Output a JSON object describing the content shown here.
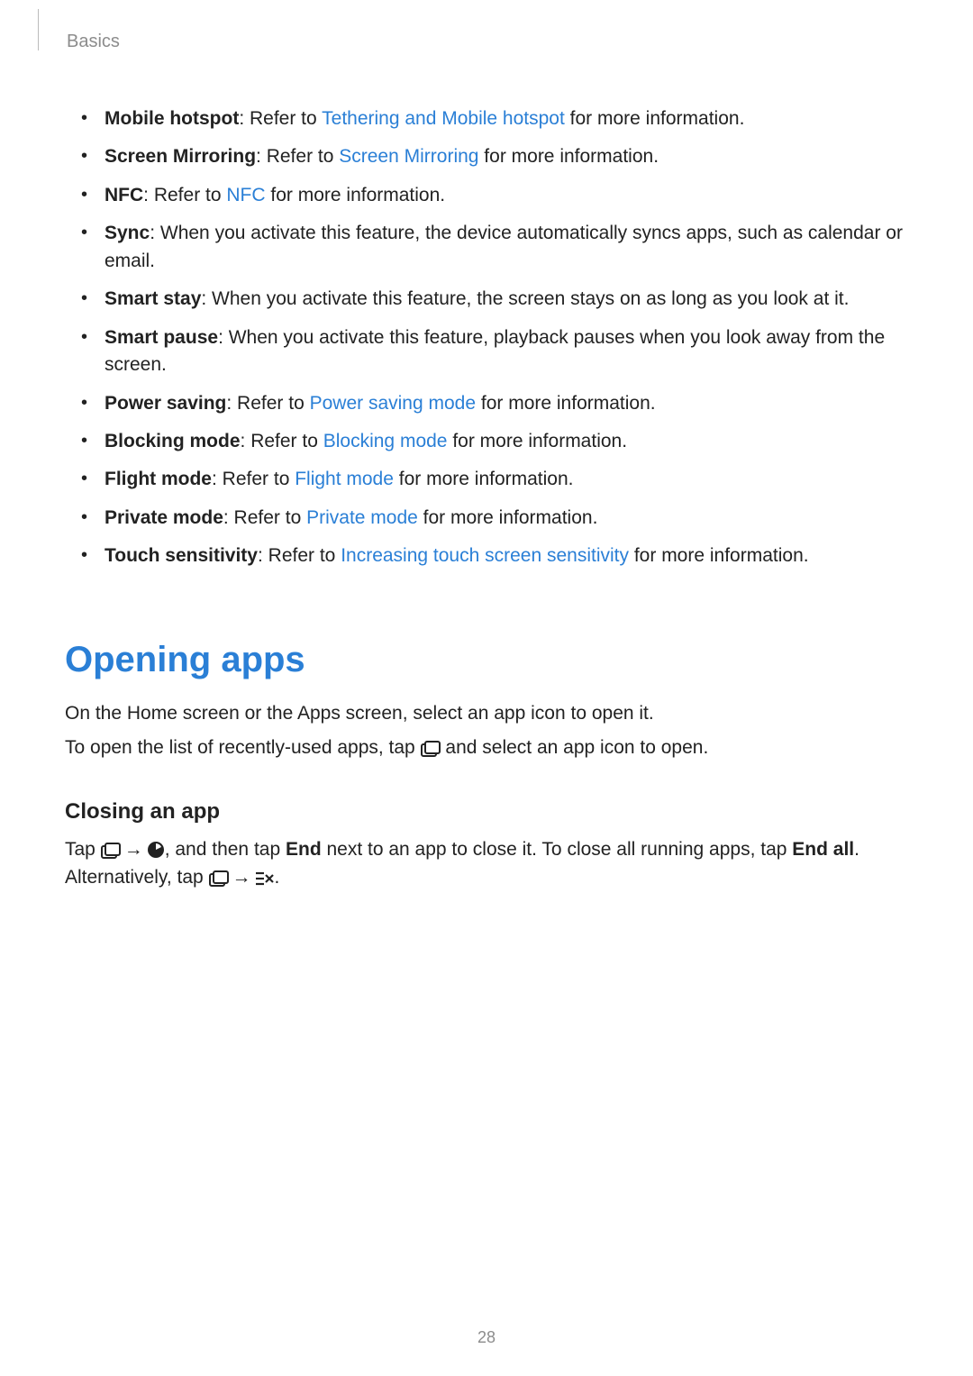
{
  "header": {
    "section": "Basics"
  },
  "features": [
    {
      "term": "Mobile hotspot",
      "before": ": Refer to ",
      "link": "Tethering and Mobile hotspot",
      "after": " for more information."
    },
    {
      "term": "Screen Mirroring",
      "before": ": Refer to ",
      "link": "Screen Mirroring",
      "after": " for more information."
    },
    {
      "term": "NFC",
      "before": ": Refer to ",
      "link": "NFC",
      "after": " for more information."
    },
    {
      "term": "Sync",
      "before": ": When you activate this feature, the device automatically syncs apps, such as calendar or email.",
      "link": "",
      "after": ""
    },
    {
      "term": "Smart stay",
      "before": ": When you activate this feature, the screen stays on as long as you look at it.",
      "link": "",
      "after": ""
    },
    {
      "term": "Smart pause",
      "before": ": When you activate this feature, playback pauses when you look away from the screen.",
      "link": "",
      "after": ""
    },
    {
      "term": "Power saving",
      "before": ": Refer to ",
      "link": "Power saving mode",
      "after": " for more information."
    },
    {
      "term": "Blocking mode",
      "before": ": Refer to ",
      "link": "Blocking mode",
      "after": " for more information."
    },
    {
      "term": "Flight mode",
      "before": ": Refer to ",
      "link": "Flight mode",
      "after": " for more information."
    },
    {
      "term": "Private mode",
      "before": ": Refer to ",
      "link": "Private mode",
      "after": " for more information."
    },
    {
      "term": "Touch sensitivity",
      "before": ": Refer to ",
      "link": "Increasing touch screen sensitivity",
      "after": " for more information."
    }
  ],
  "opening_apps": {
    "title": "Opening apps",
    "p1": "On the Home screen or the Apps screen, select an app icon to open it.",
    "p2_a": "To open the list of recently-used apps, tap ",
    "p2_b": " and select an app icon to open."
  },
  "closing_app": {
    "title": "Closing an app",
    "p_a": "Tap ",
    "arrow": "→",
    "p_b": ", and then tap ",
    "end": "End",
    "p_c": " next to an app to close it. To close all running apps, tap ",
    "end_all": "End all",
    "p_d": ". Alternatively, tap ",
    "p_e": "."
  },
  "page_number": "28",
  "icons": {
    "recent": "recent-apps-icon",
    "task_manager": "task-manager-icon",
    "close_all": "close-all-icon"
  }
}
